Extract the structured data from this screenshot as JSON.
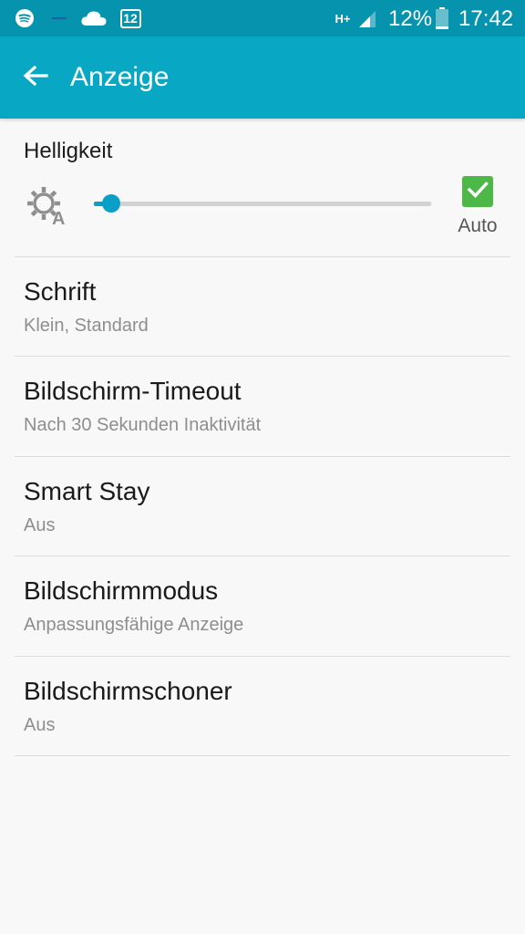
{
  "status_bar": {
    "icons": [
      "spotify-icon",
      "minus-icon",
      "cloud-icon",
      "calendar-icon",
      "hplus-network-icon",
      "signal-icon",
      "battery-icon"
    ],
    "calendar_day": "12",
    "network_type": "H+",
    "battery_percent": "12%",
    "battery_level": 0.12,
    "time": "17:42"
  },
  "app_bar": {
    "title": "Anzeige",
    "back_icon": "arrow-left-icon"
  },
  "brightness": {
    "label": "Helligkeit",
    "icon": "auto-brightness-icon",
    "level": 0.05,
    "auto_checked": true,
    "auto_label": "Auto"
  },
  "settings": [
    {
      "title": "Schrift",
      "subtitle": "Klein, Standard"
    },
    {
      "title": "Bildschirm-Timeout",
      "subtitle": "Nach 30 Sekunden Inaktivität"
    },
    {
      "title": "Smart Stay",
      "subtitle": "Aus"
    },
    {
      "title": "Bildschirmmodus",
      "subtitle": "Anpassungsfähige Anzeige"
    },
    {
      "title": "Bildschirmschoner",
      "subtitle": "Aus"
    }
  ],
  "colors": {
    "status_bar": "#0693ad",
    "app_bar": "#08a7c3",
    "accent": "#0a9fc7",
    "checkbox": "#4cb848",
    "background": "#f8f8f8"
  }
}
